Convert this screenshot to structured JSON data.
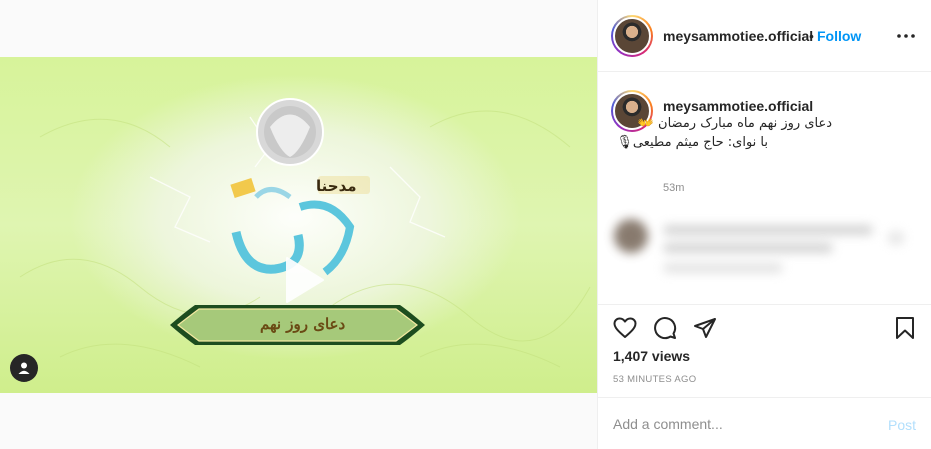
{
  "post": {
    "username": "meysammotiee.official",
    "follow_label": "Follow",
    "separator": "•",
    "caption_line_1": "دعای روز نهم ماه مبارک رمضان 👐",
    "caption_line_2": "با نوای: حاج میثم مطیعی🎙",
    "caption_time": "53m",
    "views": "1,407 views",
    "posted_ago": "53 MINUTES AGO"
  },
  "video": {
    "title_text_top": "مدحنا",
    "banner_text": "دعای روز نهم",
    "play_icon": "play-icon",
    "user_tag_icon": "person-icon"
  },
  "comment": {
    "placeholder": "Add a comment...",
    "post_label": "Post"
  },
  "colors": {
    "follow_blue": "#0095f6",
    "post_disabled": "#b2dffc",
    "muted_text": "#8e8e8e"
  }
}
